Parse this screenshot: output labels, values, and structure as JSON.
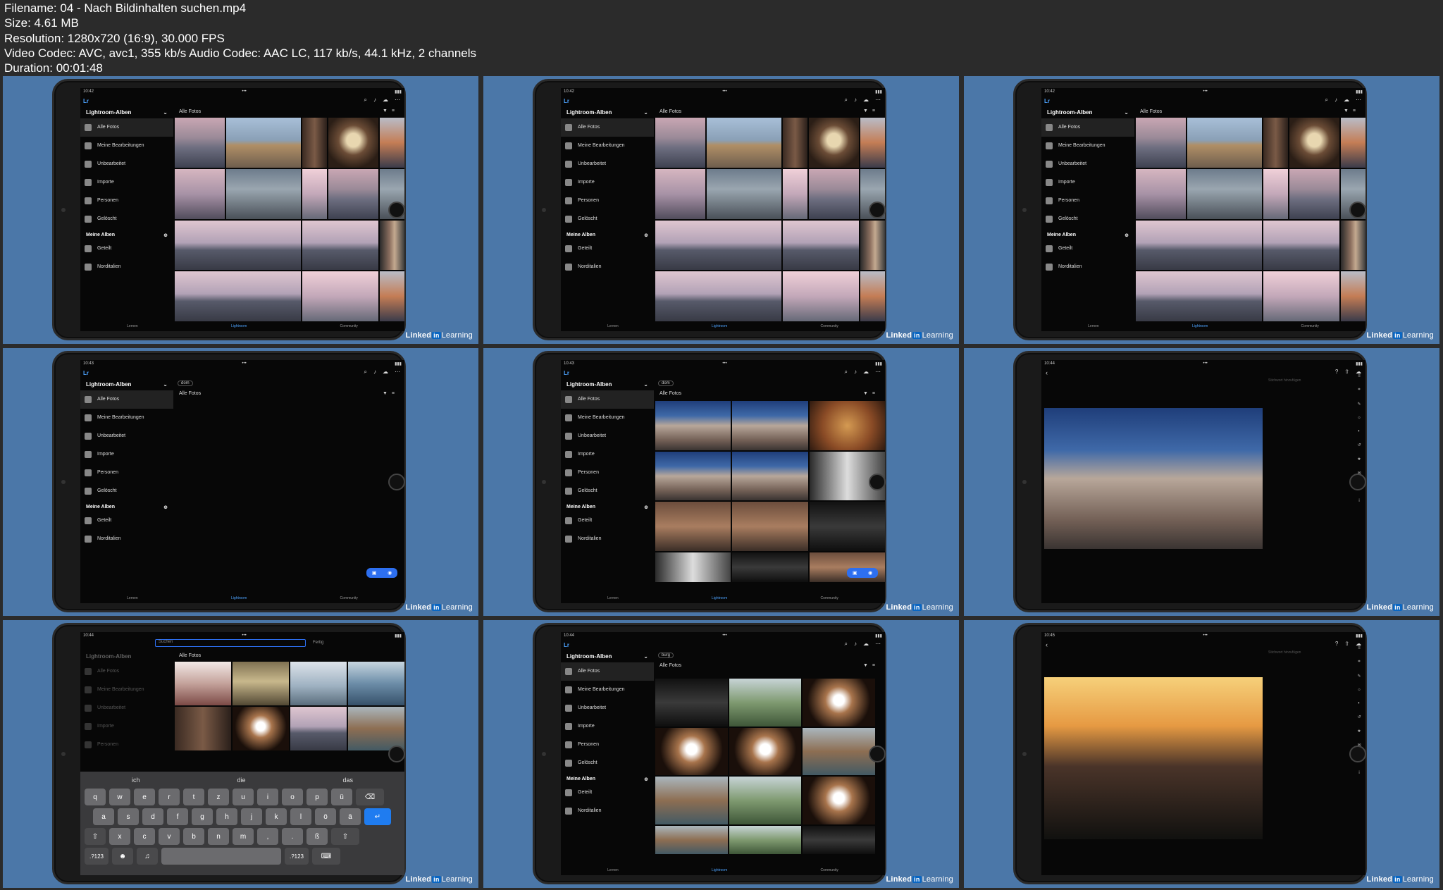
{
  "header": {
    "filename": "Filename: 04 - Nach Bildinhalten suchen.mp4",
    "size": "Size: 4.61 MB",
    "resolution": "Resolution: 1280x720 (16:9), 30.000 FPS",
    "codec": "Video Codec: AVC, avc1, 355 kb/s Audio Codec: AAC LC, 117 kb/s, 44.1 kHz, 2 channels",
    "duration": "Duration: 00:01:48"
  },
  "watermark": {
    "linked": "Linked",
    "in": "in",
    "learning": "Learning"
  },
  "app": {
    "logo": "Lr",
    "sidebar_title": "Lightroom-Alben",
    "items": [
      "Alle Fotos",
      "Meine Bearbeitungen",
      "Unbearbeitet",
      "Importe",
      "Personen",
      "Gelöscht"
    ],
    "my_albums": "Meine Alben",
    "albums": [
      "Geteilt",
      "Norditalien"
    ],
    "main_title": "Alle Fotos",
    "bottom_tabs": [
      "Lernen",
      "Lightroom",
      "Community"
    ],
    "time1": "10:42",
    "time2": "10:43",
    "time3": "10:44",
    "time4": "10:45"
  },
  "search": {
    "tag_dom": "dom",
    "tag_burg": "burg",
    "placeholder": "Suchen",
    "done": "Fertig",
    "keyword_hint": "Stichwort hinzufügen"
  },
  "keyboard": {
    "suggestions": [
      "ich",
      "die",
      "das"
    ],
    "row1": [
      "q",
      "w",
      "e",
      "r",
      "t",
      "z",
      "u",
      "i",
      "o",
      "p",
      "ü"
    ],
    "row2": [
      "a",
      "s",
      "d",
      "f",
      "g",
      "h",
      "j",
      "k",
      "l",
      "ö",
      "ä"
    ],
    "row3": [
      "x",
      "c",
      "v",
      "b",
      "n",
      "m",
      ",",
      ".",
      "ß"
    ],
    "num": ".?123"
  }
}
